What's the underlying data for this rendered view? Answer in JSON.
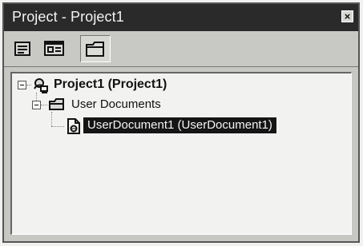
{
  "window": {
    "title": "Project - Project1",
    "close_label": "×"
  },
  "toolbar": {
    "buttons": [
      {
        "name": "view-code",
        "icon": "view-code-icon"
      },
      {
        "name": "view-object",
        "icon": "view-object-icon"
      },
      {
        "name": "toggle-folders",
        "icon": "folder-icon",
        "state": "pressed"
      }
    ]
  },
  "tree": {
    "project": {
      "label": "Project1 (Project1)",
      "icon": "project-icon",
      "expanded": true
    },
    "folder": {
      "label": "User Documents",
      "icon": "folder-icon",
      "expanded": true
    },
    "document": {
      "label": "UserDocument1 (UserDocument1)",
      "icon": "user-document-icon",
      "selected": true
    }
  },
  "colors": {
    "titlebar": "#2a2a2a",
    "selection": "#151515",
    "pane_background": "#f2f2f0"
  }
}
